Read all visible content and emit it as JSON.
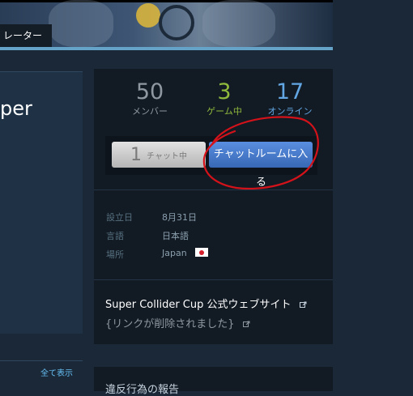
{
  "header": {
    "tab_label": "レーター"
  },
  "group": {
    "name_fragment": "per"
  },
  "stats": {
    "members": {
      "value": "50",
      "label": "メンバー"
    },
    "in_game": {
      "value": "3",
      "label": "ゲーム中"
    },
    "online": {
      "value": "17",
      "label": "オンライン"
    }
  },
  "chat": {
    "count": "1",
    "count_label": "チャット中",
    "join_label": "チャットルームに入",
    "join_label_wrap": "る"
  },
  "info": {
    "founded_label": "設立日",
    "founded_value": "8月31日",
    "language_label": "言語",
    "language_value": "日本語",
    "location_label": "場所",
    "location_value": "Japan"
  },
  "website": {
    "title": "Super Collider Cup 公式ウェブサイト",
    "removed": "{リンクが削除されました}"
  },
  "left": {
    "view_all": "全て表示"
  },
  "report": {
    "title": "違反行為の報告"
  },
  "colors": {
    "background": "#1b2838",
    "panel": "#121a24",
    "in_game": "#90ba3c",
    "online": "#62a7e3",
    "join_button": "#3d6fbd",
    "annotation": "#d4121a"
  },
  "icons": {
    "external_link": "external-link-icon",
    "flag": "japan-flag-icon"
  }
}
